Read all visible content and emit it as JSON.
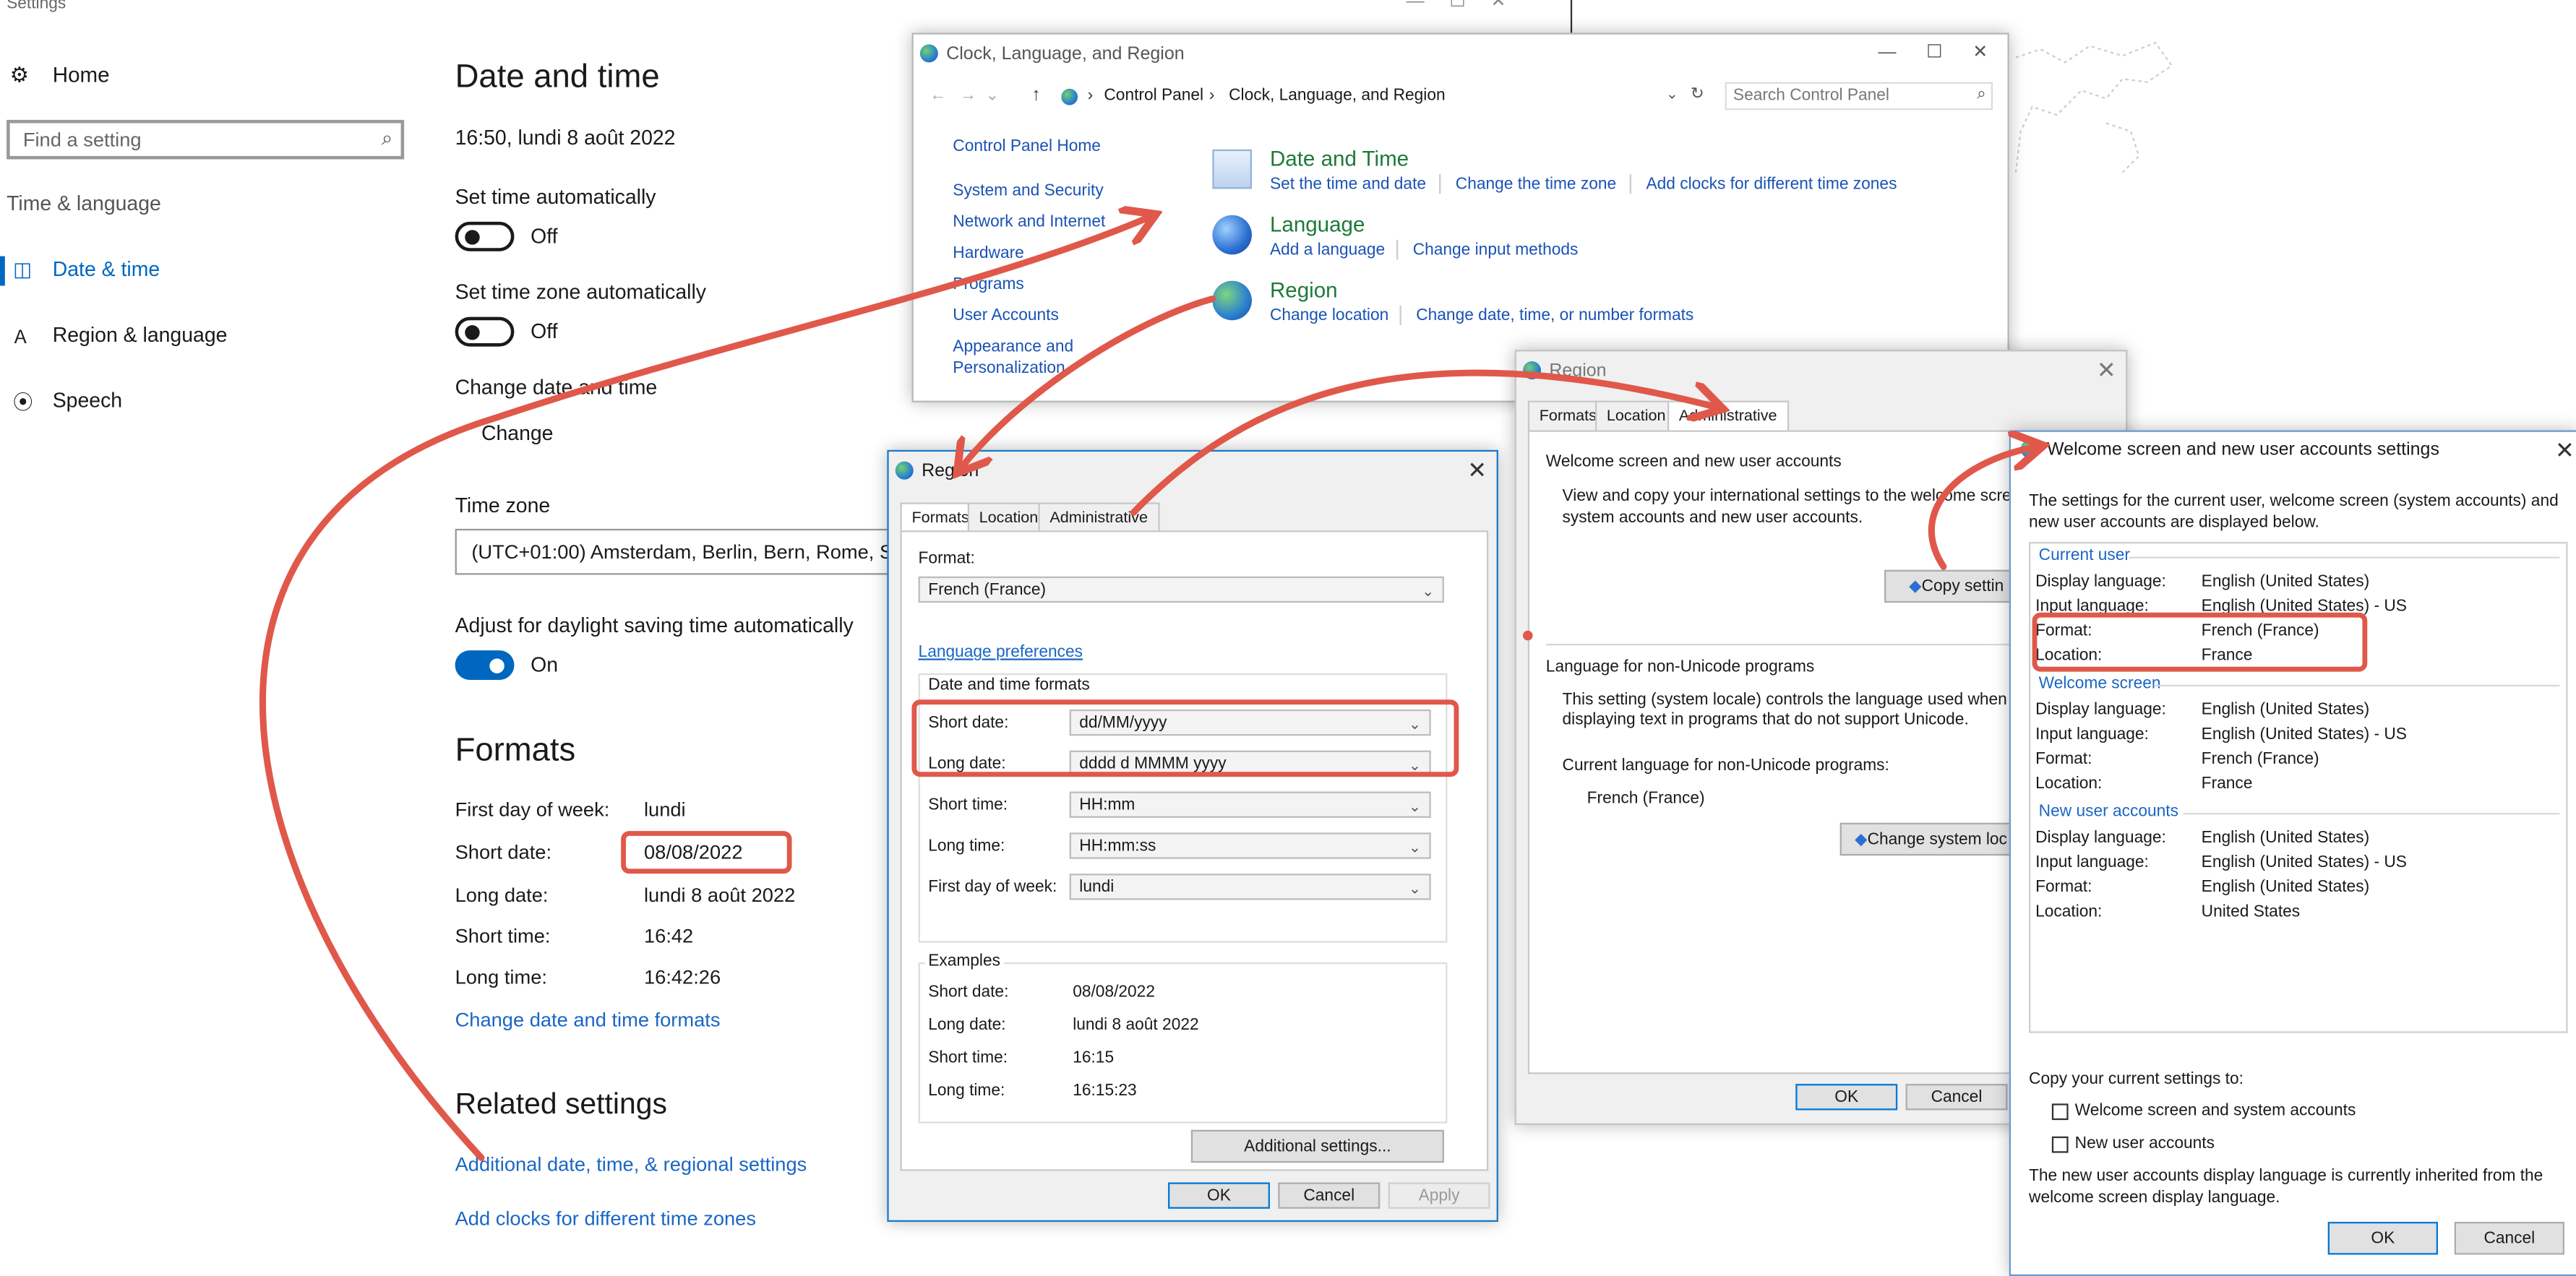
{
  "settings": {
    "window_title": "Settings",
    "nav": {
      "home": "Home",
      "search_placeholder": "Find a setting",
      "section": "Time & language",
      "items": [
        "Date & time",
        "Region & language",
        "Speech"
      ]
    },
    "page_title": "Date and time",
    "current_datetime": "16:50, lundi 8 août 2022",
    "set_time_auto": {
      "label": "Set time automatically",
      "state": "Off"
    },
    "set_tz_auto": {
      "label": "Set time zone automatically",
      "state": "Off"
    },
    "change_dt": {
      "label": "Change date and time",
      "button": "Change"
    },
    "time_zone": {
      "label": "Time zone",
      "value": "(UTC+01:00) Amsterdam, Berlin, Bern, Rome, St"
    },
    "dst": {
      "label": "Adjust for daylight saving time automatically",
      "state": "On"
    },
    "formats": {
      "title": "Formats",
      "rows": [
        {
          "label": "First day of week:",
          "value": "lundi"
        },
        {
          "label": "Short date:",
          "value": "08/08/2022"
        },
        {
          "label": "Long date:",
          "value": "lundi 8 août 2022"
        },
        {
          "label": "Short time:",
          "value": "16:42"
        },
        {
          "label": "Long time:",
          "value": "16:42:26"
        }
      ],
      "change_link": "Change date and time formats"
    },
    "related": {
      "title": "Related settings",
      "links": [
        "Additional date, time, & regional settings",
        "Add clocks for different time zones"
      ]
    }
  },
  "control_panel": {
    "title": "Clock, Language, and Region",
    "breadcrumb": [
      "Control Panel",
      "Clock, Language, and Region"
    ],
    "search_placeholder": "Search Control Panel",
    "left_nav": [
      "Control Panel Home",
      "System and Security",
      "Network and Internet",
      "Hardware",
      "Programs",
      "User Accounts",
      "Appearance and",
      "Personalization"
    ],
    "categories": [
      {
        "title": "Date and Time",
        "links": [
          "Set the time and date",
          "Change the time zone",
          "Add clocks for different time zones"
        ]
      },
      {
        "title": "Language",
        "links": [
          "Add a language",
          "Change input methods"
        ]
      },
      {
        "title": "Region",
        "links": [
          "Change location",
          "Change date, time, or number formats"
        ]
      }
    ]
  },
  "region_formats": {
    "title": "Region",
    "tabs": [
      "Formats",
      "Location",
      "Administrative"
    ],
    "format_label": "Format:",
    "format_value": "French (France)",
    "language_prefs": "Language preferences",
    "dt_group": "Date and time formats",
    "fields": [
      {
        "label": "Short date:",
        "value": "dd/MM/yyyy"
      },
      {
        "label": "Long date:",
        "value": "dddd d MMMM yyyy"
      },
      {
        "label": "Short time:",
        "value": "HH:mm"
      },
      {
        "label": "Long time:",
        "value": "HH:mm:ss"
      },
      {
        "label": "First day of week:",
        "value": "lundi"
      }
    ],
    "examples_title": "Examples",
    "examples": [
      {
        "label": "Short date:",
        "value": "08/08/2022"
      },
      {
        "label": "Long date:",
        "value": "lundi 8 août 2022"
      },
      {
        "label": "Short time:",
        "value": "16:15"
      },
      {
        "label": "Long time:",
        "value": "16:15:23"
      }
    ],
    "additional": "Additional settings...",
    "buttons": {
      "ok": "OK",
      "cancel": "Cancel",
      "apply": "Apply"
    }
  },
  "region_admin": {
    "title": "Region",
    "tabs": [
      "Formats",
      "Location",
      "Administrative"
    ],
    "welcome_group": "Welcome screen and new user accounts",
    "welcome_text_1": "View and copy your international settings to the welcome scre",
    "welcome_text_2": "system accounts and new user accounts.",
    "copy_button": "Copy settin",
    "nonunicode_group": "Language for non-Unicode programs",
    "nonunicode_text_1": "This setting (system locale) controls the language used when",
    "nonunicode_text_2": "displaying text in programs that do not support Unicode.",
    "current_label": "Current language for non-Unicode programs:",
    "current_value": "French (France)",
    "change_button": "Change system loc",
    "buttons": {
      "ok": "OK",
      "cancel": "Cancel"
    }
  },
  "welcome": {
    "title": "Welcome screen and new user accounts settings",
    "intro_1": "The settings for the current user, welcome screen (system accounts) and",
    "intro_2": "new user accounts are displayed below.",
    "sections": [
      {
        "title": "Current user",
        "rows": [
          {
            "label": "Display language:",
            "value": "English (United States)"
          },
          {
            "label": "Input language:",
            "value": "English (United States) - US"
          },
          {
            "label": "Format:",
            "value": "French (France)"
          },
          {
            "label": "Location:",
            "value": "France"
          }
        ]
      },
      {
        "title": "Welcome screen",
        "rows": [
          {
            "label": "Display language:",
            "value": "English (United States)"
          },
          {
            "label": "Input language:",
            "value": "English (United States) - US"
          },
          {
            "label": "Format:",
            "value": "French (France)"
          },
          {
            "label": "Location:",
            "value": "France"
          }
        ]
      },
      {
        "title": "New user accounts",
        "rows": [
          {
            "label": "Display language:",
            "value": "English (United States)"
          },
          {
            "label": "Input language:",
            "value": "English (United States) - US"
          },
          {
            "label": "Format:",
            "value": "English (United States)"
          },
          {
            "label": "Location:",
            "value": "United States"
          }
        ]
      }
    ],
    "copy_to": "Copy your current settings to:",
    "checkboxes": [
      "Welcome screen and system accounts",
      "New user accounts"
    ],
    "note_1": "The new user accounts display language is currently inherited from the",
    "note_2": "welcome screen display language.",
    "buttons": {
      "ok": "OK",
      "cancel": "Cancel"
    }
  },
  "colors": {
    "accent": "#0067c0",
    "link": "#1a66c5",
    "annotation": "#e0584a",
    "cp_green": "#1e7a3a"
  }
}
